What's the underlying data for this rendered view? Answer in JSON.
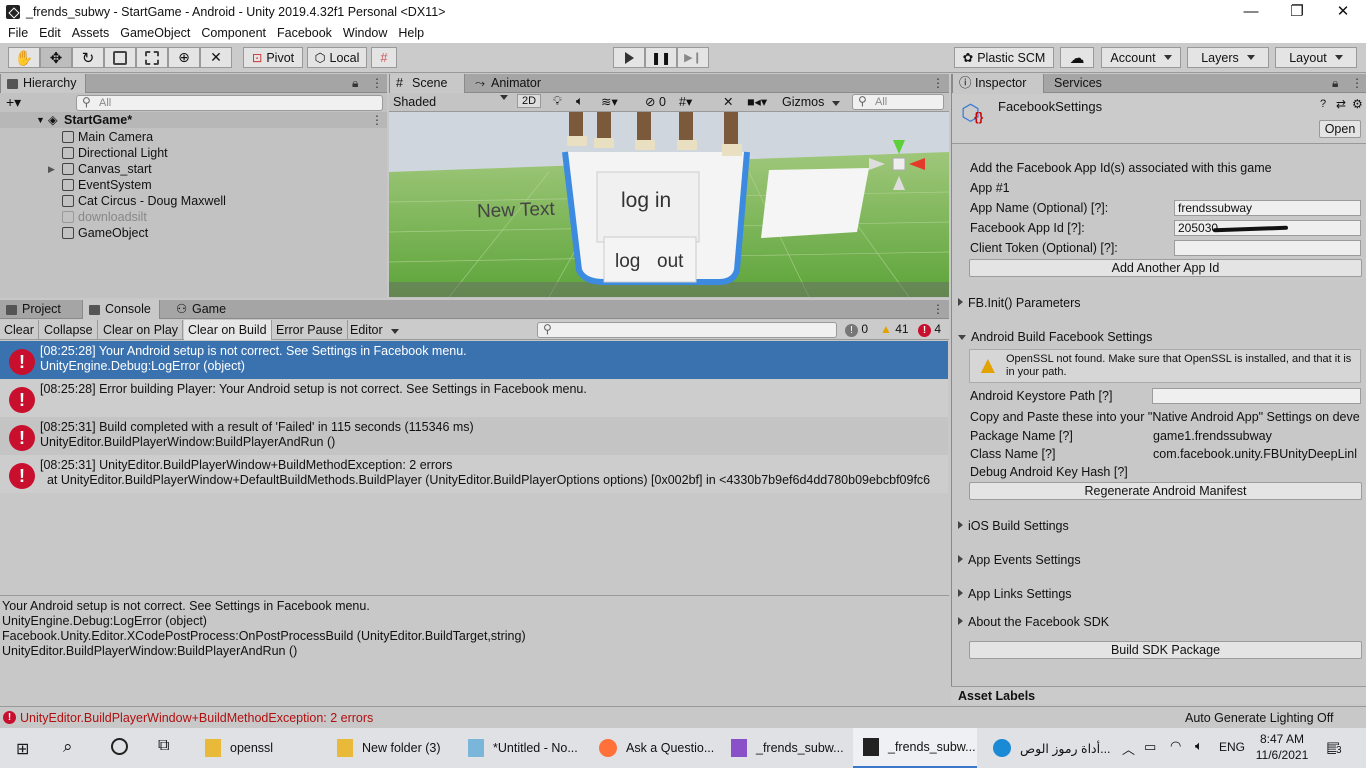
{
  "window": {
    "title": "_frends_subwy - StartGame - Android - Unity 2019.4.32f1 Personal <DX11>",
    "minimize": "—",
    "maximize": "❐",
    "close": "✕"
  },
  "menu": [
    "File",
    "Edit",
    "Assets",
    "GameObject",
    "Component",
    "Facebook",
    "Window",
    "Help"
  ],
  "toolbar": {
    "pivot": "Pivot",
    "local": "Local",
    "plastic": "Plastic SCM",
    "account": "Account",
    "layers": "Layers",
    "layout": "Layout"
  },
  "hierarchy": {
    "tab": "Hierarchy",
    "search_placeholder": "All",
    "scene": "StartGame*",
    "items": [
      "Main Camera",
      "Directional Light",
      "Canvas_start",
      "EventSystem",
      "Cat Circus - Doug Maxwell",
      "downloadsilt",
      "GameObject"
    ]
  },
  "scene": {
    "tabs": [
      "Scene",
      "Animator"
    ],
    "shading": "Shaded",
    "mode_2d": "2D",
    "hidden_count": "0",
    "gizmos": "Gizmos",
    "search_placeholder": "All",
    "texts": {
      "new_text": "New Text",
      "login": "log in",
      "logout_a": "log",
      "logout_b": "out"
    }
  },
  "console": {
    "tabs": [
      "Project",
      "Console",
      "Game"
    ],
    "buttons": [
      "Clear",
      "Collapse",
      "Clear on Play",
      "Clear on Build",
      "Error Pause",
      "Editor"
    ],
    "counts": {
      "info": "0",
      "warn": "41",
      "error": "4"
    },
    "entries": [
      {
        "line1": "[08:25:28] Your Android setup is not correct. See Settings in Facebook menu.",
        "line2": "UnityEngine.Debug:LogError (object)"
      },
      {
        "line1": "[08:25:28] Error building Player: Your Android setup is not correct. See Settings in Facebook menu.",
        "line2": ""
      },
      {
        "line1": "[08:25:31] Build completed with a result of 'Failed' in 115 seconds (115346 ms)",
        "line2": "UnityEditor.BuildPlayerWindow:BuildPlayerAndRun ()"
      },
      {
        "line1": "[08:25:31] UnityEditor.BuildPlayerWindow+BuildMethodException: 2 errors",
        "line2": "  at UnityEditor.BuildPlayerWindow+DefaultBuildMethods.BuildPlayer (UnityEditor.BuildPlayerOptions options) [0x002bf] in <4330b7b9ef6d4dd780b09ebcbf09fc6"
      }
    ],
    "detail": [
      "Your Android setup is not correct. See Settings in Facebook menu.",
      "UnityEngine.Debug:LogError (object)",
      "Facebook.Unity.Editor.XCodePostProcess:OnPostProcessBuild (UnityEditor.BuildTarget,string)",
      "UnityEditor.BuildPlayerWindow:BuildPlayerAndRun ()"
    ]
  },
  "inspector": {
    "tabs": [
      "Inspector",
      "Services"
    ],
    "object_name": "FacebookSettings",
    "open": "Open",
    "intro": "Add the Facebook App Id(s) associated with this game",
    "app_num": "App #1",
    "app_name_label": "App Name (Optional) [?]:",
    "app_name_value": "frendssubway",
    "app_id_label": "Facebook App Id [?]:",
    "app_id_value": "205030",
    "client_token_label": "Client Token (Optional) [?]:",
    "add_app_btn": "Add Another App Id",
    "fb_init": "FB.Init() Parameters",
    "android_build": "Android Build Facebook Settings",
    "openssl_warning": "OpenSSL not found. Make sure that OpenSSL is installed, and that it is in your path.",
    "keystore_label": "Android Keystore Path [?]",
    "copy_paste": "Copy and Paste these into your \"Native Android App\" Settings on deve",
    "package_label": "Package Name [?]",
    "package_value": "game1.frendssubway",
    "class_label": "Class Name [?]",
    "class_value": "com.facebook.unity.FBUnityDeepLinl",
    "debug_hash_label": "Debug Android Key Hash [?]",
    "regen_btn": "Regenerate Android Manifest",
    "ios": "iOS Build Settings",
    "events": "App Events Settings",
    "links": "App Links Settings",
    "about": "About the Facebook SDK",
    "build_sdk": "Build SDK Package",
    "asset_labels": "Asset Labels"
  },
  "statusbar": {
    "error": "UnityEditor.BuildPlayerWindow+BuildMethodException: 2 errors",
    "lighting": "Auto Generate Lighting Off"
  },
  "taskbar": {
    "apps": [
      "openssl",
      "New folder (3)",
      "*Untitled - No...",
      "Ask a Questio...",
      "_frends_subw...",
      "_frends_subw...",
      "أداة رموز الوص..."
    ],
    "lang": "ENG",
    "time": "8:47 AM",
    "date": "11/6/2021",
    "notif": "3"
  }
}
